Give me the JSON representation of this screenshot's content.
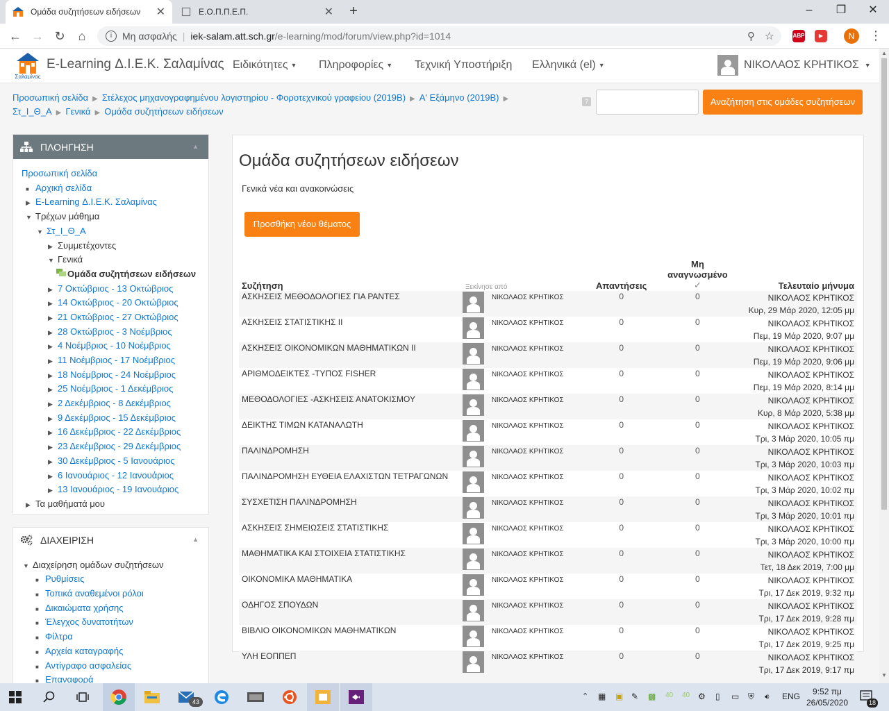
{
  "browser": {
    "tabs": [
      {
        "title": "Ομάδα συζητήσεων ειδήσεων",
        "active": true
      },
      {
        "title": "Ε.Ο.Π.Π.Ε.Π.",
        "active": false
      }
    ],
    "omnibox": {
      "security_label": "Μη ασφαλής",
      "host": "iek-salam.att.sch.gr",
      "path": "/e-learning/mod/forum/view.php?id=1014"
    },
    "extensions": [
      "ABP",
      "▶"
    ],
    "profile_initial": "N"
  },
  "header": {
    "logo_caption": "Σαλαμίνας",
    "site_name": "E-Learning Δ.Ι.Ε.Κ. Σαλαμίνας",
    "menus": [
      "Ειδικότητες",
      "Πληροφορίες",
      "Τεχνική Υποστήριξη",
      "Ελληνικά (el)"
    ],
    "user_name": "ΝΙΚΟΛΑΟΣ ΚΡΗΤΙΚΟΣ"
  },
  "breadcrumb": {
    "items": [
      "Προσωπική σελίδα",
      "Στέλεχος μηχανογραφημένου λογιστηρίου - Φοροτεχνικού γραφείου (2019Β)",
      "Α' Εξάμηνο (2019Β)",
      "Στ_Ι_Θ_Α",
      "Γενικά",
      "Ομάδα συζητήσεων ειδήσεων"
    ]
  },
  "search": {
    "help": "?",
    "button_label": "Αναζήτηση στις ομάδες συζητήσεων",
    "value": ""
  },
  "navigation": {
    "title": "ΠΛΟΗΓΗΣΗ",
    "items": [
      {
        "label": "Προσωπική σελίδα"
      },
      {
        "label": "Αρχική σελίδα"
      },
      {
        "label": "E-Learning Δ.Ι.Ε.Κ. Σαλαμίνας"
      },
      {
        "label": "Τρέχων μάθημα"
      },
      {
        "label": "Στ_Ι_Θ_Α"
      },
      {
        "label": "Συμμετέχοντες"
      },
      {
        "label": "Γενικά"
      },
      {
        "label": "Ομάδα συζητήσεων ειδήσεων"
      },
      {
        "label": "7 Οκτώβριος - 13 Οκτώβριος"
      },
      {
        "label": "14 Οκτώβριος - 20 Οκτώβριος"
      },
      {
        "label": "21 Οκτώβριος - 27 Οκτώβριος"
      },
      {
        "label": "28 Οκτώβριος - 3 Νοέμβριος"
      },
      {
        "label": "4 Νοέμβριος - 10 Νοέμβριος"
      },
      {
        "label": "11 Νοέμβριος - 17 Νοέμβριος"
      },
      {
        "label": "18 Νοέμβριος - 24 Νοέμβριος"
      },
      {
        "label": "25 Νοέμβριος - 1 Δεκέμβριος"
      },
      {
        "label": "2 Δεκέμβριος - 8 Δεκέμβριος"
      },
      {
        "label": "9 Δεκέμβριος - 15 Δεκέμβριος"
      },
      {
        "label": "16 Δεκέμβριος - 22 Δεκέμβριος"
      },
      {
        "label": "23 Δεκέμβριος - 29 Δεκέμβριος"
      },
      {
        "label": "30 Δεκέμβριος - 5 Ιανουάριος"
      },
      {
        "label": "6 Ιανουάριος - 12 Ιανουάριος"
      },
      {
        "label": "13 Ιανουάριος - 19 Ιανουάριος"
      },
      {
        "label": "Τα μαθήματά μου"
      }
    ]
  },
  "administration": {
    "title": "ΔΙΑΧΕΙΡΙΣΗ",
    "items": [
      {
        "label": "Διαχείρηση ομάδων συζητήσεων"
      },
      {
        "label": "Ρυθμίσεις"
      },
      {
        "label": "Τοπικά αναθεμένοι ρόλοι"
      },
      {
        "label": "Δικαιώματα χρήσης"
      },
      {
        "label": "Έλεγχος δυνατοτήτων"
      },
      {
        "label": "Φίλτρα"
      },
      {
        "label": "Αρχεία καταγραφής"
      },
      {
        "label": "Αντίγραφο ασφαλείας"
      },
      {
        "label": "Επαναφορά"
      }
    ]
  },
  "forum": {
    "title": "Ομάδα συζητήσεων ειδήσεων",
    "intro": "Γενικά νέα και ανακοινώσεις",
    "add_button": "Προσθήκη νέου θέματος",
    "columns": {
      "discussion": "Συζήτηση",
      "started_by": "Ξεκίνησε από",
      "replies": "Απαντήσεις",
      "unread": "Μη αναγνωσμένο",
      "unread_mark": "✓",
      "last_post": "Τελευταίο μήνυμα"
    },
    "discussions": [
      {
        "topic": "ΑΣΚΗΣΕΙΣ ΜΕΘΟΔΟΛΟΓΙΕΣ ΓΙΑ ΡΑΝΤΕΣ",
        "author": "ΝΙΚΟΛΑΟΣ ΚΡΗΤΙΚΟΣ",
        "replies": "0",
        "unread": "0",
        "last_user": "ΝΙΚΟΛΑΟΣ ΚΡΗΤΙΚΟΣ",
        "last_date": "Κυρ, 29 Μάρ 2020, 12:05 μμ"
      },
      {
        "topic": "ΑΣΚΗΣΕΙΣ ΣΤΑΤΙΣΤΙΚΗΣ ΙΙ",
        "author": "ΝΙΚΟΛΑΟΣ ΚΡΗΤΙΚΟΣ",
        "replies": "0",
        "unread": "0",
        "last_user": "ΝΙΚΟΛΑΟΣ ΚΡΗΤΙΚΟΣ",
        "last_date": "Πεμ, 19 Μάρ 2020, 9:07 μμ"
      },
      {
        "topic": "ΑΣΚΗΣΕΙΣ ΟΙΚΟΝΟΜΙΚΩΝ ΜΑΘΗΜΑΤΙΚΩΝ ΙΙ",
        "author": "ΝΙΚΟΛΑΟΣ ΚΡΗΤΙΚΟΣ",
        "replies": "0",
        "unread": "0",
        "last_user": "ΝΙΚΟΛΑΟΣ ΚΡΗΤΙΚΟΣ",
        "last_date": "Πεμ, 19 Μάρ 2020, 9:06 μμ"
      },
      {
        "topic": "ΑΡΙΘΜΟΔΕΙΚΤΕΣ -ΤΥΠΟΣ FISHER",
        "author": "ΝΙΚΟΛΑΟΣ ΚΡΗΤΙΚΟΣ",
        "replies": "0",
        "unread": "0",
        "last_user": "ΝΙΚΟΛΑΟΣ ΚΡΗΤΙΚΟΣ",
        "last_date": "Πεμ, 19 Μάρ 2020, 8:14 μμ"
      },
      {
        "topic": "ΜΕΘΟΔΟΛΟΓΙΕΣ -ΑΣΚΗΣΕΙΣ ΑΝΑΤΟΚΙΣΜΟΥ",
        "author": "ΝΙΚΟΛΑΟΣ ΚΡΗΤΙΚΟΣ",
        "replies": "0",
        "unread": "0",
        "last_user": "ΝΙΚΟΛΑΟΣ ΚΡΗΤΙΚΟΣ",
        "last_date": "Κυρ, 8 Μάρ 2020, 5:38 μμ"
      },
      {
        "topic": "ΔΕΙΚΤΗΣ ΤΙΜΩΝ ΚΑΤΑΝΑΛΩΤΗ",
        "author": "ΝΙΚΟΛΑΟΣ ΚΡΗΤΙΚΟΣ",
        "replies": "0",
        "unread": "0",
        "last_user": "ΝΙΚΟΛΑΟΣ ΚΡΗΤΙΚΟΣ",
        "last_date": "Τρι, 3 Μάρ 2020, 10:05 πμ"
      },
      {
        "topic": "ΠΑΛΙΝΔΡΟΜΗΣΗ",
        "author": "ΝΙΚΟΛΑΟΣ ΚΡΗΤΙΚΟΣ",
        "replies": "0",
        "unread": "0",
        "last_user": "ΝΙΚΟΛΑΟΣ ΚΡΗΤΙΚΟΣ",
        "last_date": "Τρι, 3 Μάρ 2020, 10:03 πμ"
      },
      {
        "topic": "ΠΑΛΙΝΔΡΟΜΗΣΗ ΕΥΘΕΙΑ ΕΛΑΧΙΣΤΩΝ ΤΕΤΡΑΓΩΝΩΝ",
        "author": "ΝΙΚΟΛΑΟΣ ΚΡΗΤΙΚΟΣ",
        "replies": "0",
        "unread": "0",
        "last_user": "ΝΙΚΟΛΑΟΣ ΚΡΗΤΙΚΟΣ",
        "last_date": "Τρι, 3 Μάρ 2020, 10:02 πμ"
      },
      {
        "topic": "ΣΥΣΧΕΤΙΣΗ ΠΑΛΙΝΔΡΟΜΗΣΗ",
        "author": "ΝΙΚΟΛΑΟΣ ΚΡΗΤΙΚΟΣ",
        "replies": "0",
        "unread": "0",
        "last_user": "ΝΙΚΟΛΑΟΣ ΚΡΗΤΙΚΟΣ",
        "last_date": "Τρι, 3 Μάρ 2020, 10:01 πμ"
      },
      {
        "topic": "ΑΣΚΗΣΕΙΣ ΣΗΜΕΙΩΣΕΙΣ ΣΤΑΤΙΣΤΙΚΗΣ",
        "author": "ΝΙΚΟΛΑΟΣ ΚΡΗΤΙΚΟΣ",
        "replies": "0",
        "unread": "0",
        "last_user": "ΝΙΚΟΛΑΟΣ ΚΡΗΤΙΚΟΣ",
        "last_date": "Τρι, 3 Μάρ 2020, 10:00 πμ"
      },
      {
        "topic": "ΜΑΘΗΜΑΤΙΚΑ ΚΑΙ ΣΤΟΙΧΕΙΑ ΣΤΑΤΙΣΤΙΚΗΣ",
        "author": "ΝΙΚΟΛΑΟΣ ΚΡΗΤΙΚΟΣ",
        "replies": "0",
        "unread": "0",
        "last_user": "ΝΙΚΟΛΑΟΣ ΚΡΗΤΙΚΟΣ",
        "last_date": "Τετ, 18 Δεκ 2019, 7:00 μμ"
      },
      {
        "topic": "ΟΙΚΟΝΟΜΙΚΑ ΜΑΘΗΜΑΤΙΚΑ",
        "author": "ΝΙΚΟΛΑΟΣ ΚΡΗΤΙΚΟΣ",
        "replies": "0",
        "unread": "0",
        "last_user": "ΝΙΚΟΛΑΟΣ ΚΡΗΤΙΚΟΣ",
        "last_date": "Τρι, 17 Δεκ 2019, 9:32 πμ"
      },
      {
        "topic": "ΟΔΗΓΟΣ ΣΠΟΥΔΩΝ",
        "author": "ΝΙΚΟΛΑΟΣ ΚΡΗΤΙΚΟΣ",
        "replies": "0",
        "unread": "0",
        "last_user": "ΝΙΚΟΛΑΟΣ ΚΡΗΤΙΚΟΣ",
        "last_date": "Τρι, 17 Δεκ 2019, 9:28 πμ"
      },
      {
        "topic": "ΒΙΒΛΙΟ ΟΙΚΟΝΟΜΙΚΩΝ ΜΑΘΗΜΑΤΙΚΩΝ",
        "author": "ΝΙΚΟΛΑΟΣ ΚΡΗΤΙΚΟΣ",
        "replies": "0",
        "unread": "0",
        "last_user": "ΝΙΚΟΛΑΟΣ ΚΡΗΤΙΚΟΣ",
        "last_date": "Τρι, 17 Δεκ 2019, 9:25 πμ"
      },
      {
        "topic": "ΥΛΗ ΕΟΠΠΕΠ",
        "author": "ΝΙΚΟΛΑΟΣ ΚΡΗΤΙΚΟΣ",
        "replies": "0",
        "unread": "0",
        "last_user": "ΝΙΚΟΛΑΟΣ ΚΡΗΤΙΚΟΣ",
        "last_date": "Τρι, 17 Δεκ 2019, 9:17 πμ"
      }
    ]
  },
  "taskbar": {
    "mail_badge": "43",
    "tray_numbers": [
      "40",
      "40"
    ],
    "language": "ENG",
    "time": "9:52 πμ",
    "date": "26/05/2020",
    "notification_count": "18"
  },
  "colors": {
    "accent": "#f98012",
    "link": "#1177d1",
    "nav_header": "#6c7a80"
  }
}
